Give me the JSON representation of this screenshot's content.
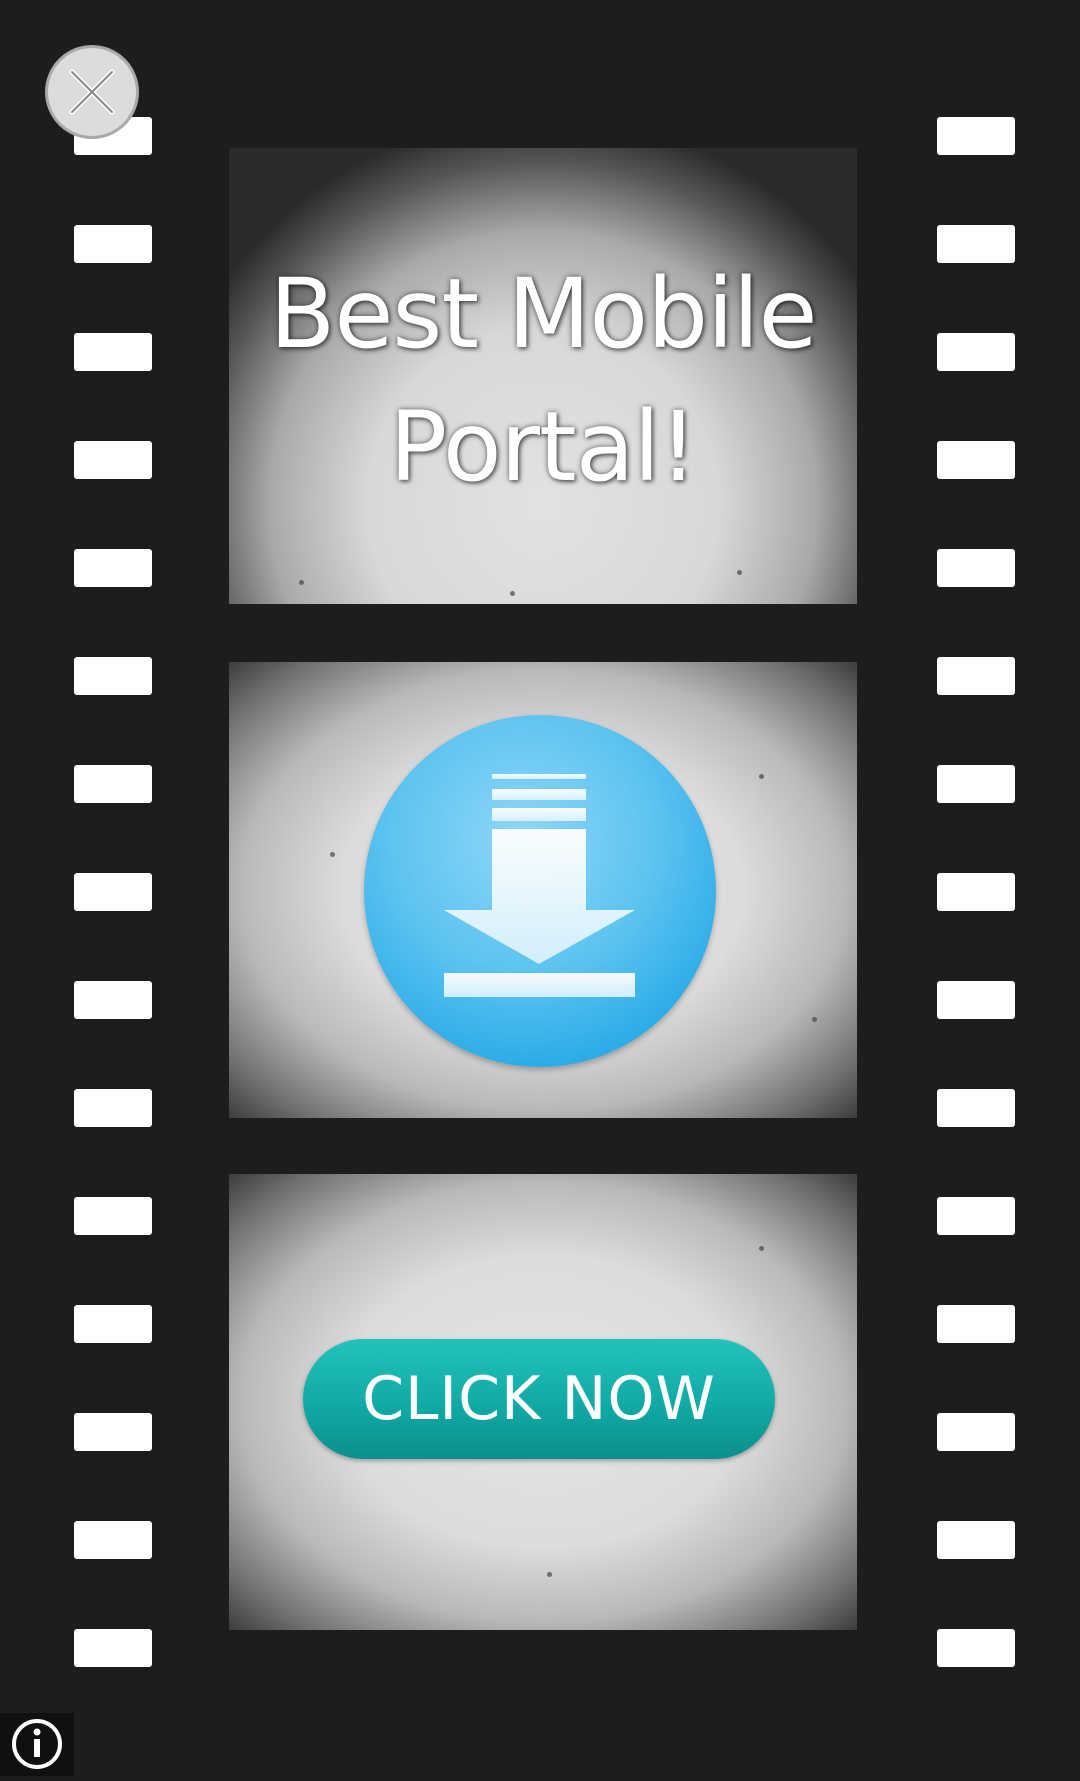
{
  "ad": {
    "headline_line1": "Best Mobile",
    "headline_line2": "Portal!",
    "cta_label": "CLICK NOW"
  },
  "icons": {
    "close": "close-icon",
    "download": "download-icon",
    "info": "info-icon"
  },
  "colors": {
    "background": "#1d1d1d",
    "film_hole": "#ffffff",
    "download_circle": "#3fb6ee",
    "cta": "#14aaa6"
  }
}
